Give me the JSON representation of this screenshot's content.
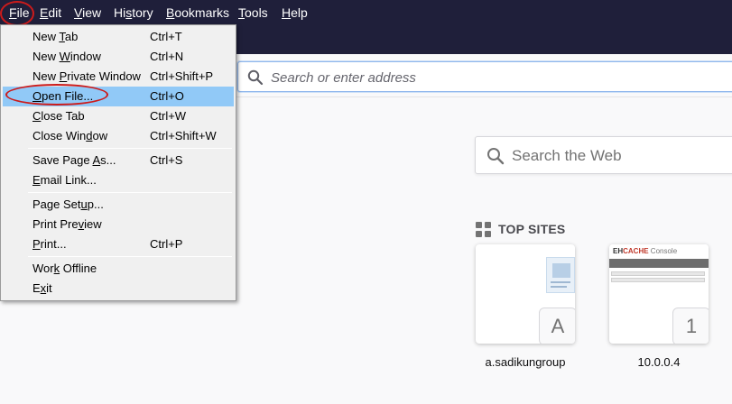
{
  "menubar": {
    "items": [
      {
        "pre": "",
        "acc": "F",
        "post": "ile"
      },
      {
        "pre": "",
        "acc": "E",
        "post": "dit"
      },
      {
        "pre": "",
        "acc": "V",
        "post": "iew"
      },
      {
        "pre": "Hi",
        "acc": "s",
        "post": "tory"
      },
      {
        "pre": "",
        "acc": "B",
        "post": "ookmarks"
      },
      {
        "pre": "",
        "acc": "T",
        "post": "ools"
      },
      {
        "pre": "",
        "acc": "H",
        "post": "elp"
      }
    ]
  },
  "file_menu": {
    "items": [
      {
        "pre": "New ",
        "acc": "T",
        "post": "ab",
        "shortcut": "Ctrl+T"
      },
      {
        "pre": "New ",
        "acc": "W",
        "post": "indow",
        "shortcut": "Ctrl+N"
      },
      {
        "pre": "New ",
        "acc": "P",
        "post": "rivate Window",
        "shortcut": "Ctrl+Shift+P"
      },
      {
        "pre": "",
        "acc": "O",
        "post": "pen File...",
        "shortcut": "Ctrl+O"
      },
      {
        "pre": "",
        "acc": "C",
        "post": "lose Tab",
        "shortcut": "Ctrl+W"
      },
      {
        "pre": "Close Win",
        "acc": "d",
        "post": "ow",
        "shortcut": "Ctrl+Shift+W"
      },
      {
        "pre": "Save Page ",
        "acc": "A",
        "post": "s...",
        "shortcut": "Ctrl+S"
      },
      {
        "pre": "",
        "acc": "E",
        "post": "mail Link...",
        "shortcut": ""
      },
      {
        "pre": "Page Set",
        "acc": "u",
        "post": "p...",
        "shortcut": ""
      },
      {
        "pre": "Print Pre",
        "acc": "v",
        "post": "iew",
        "shortcut": ""
      },
      {
        "pre": "",
        "acc": "P",
        "post": "rint...",
        "shortcut": "Ctrl+P"
      },
      {
        "pre": "Wor",
        "acc": "k",
        "post": " Offline",
        "shortcut": ""
      },
      {
        "pre": "E",
        "acc": "x",
        "post": "it",
        "shortcut": ""
      }
    ]
  },
  "urlbar": {
    "placeholder": "Search or enter address"
  },
  "websearch": {
    "placeholder": "Search the Web"
  },
  "topsites": {
    "heading": "TOP SITES",
    "tiles": [
      {
        "label": "a.sadikungroup",
        "badge": "A"
      },
      {
        "label": "10.0.0.4",
        "badge": "1"
      }
    ],
    "thumb2": {
      "brand_a": "EH",
      "brand_b": "CACHE",
      "brand_c": " Console"
    }
  },
  "colors": {
    "chrome": "#1f1f3a",
    "highlight": "#91c9f7",
    "annotation": "#cc1b1b"
  }
}
